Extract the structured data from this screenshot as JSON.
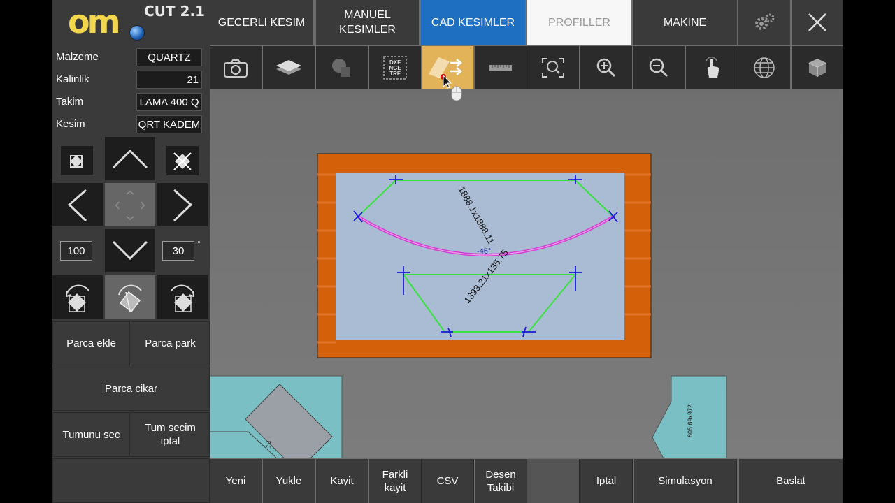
{
  "logo": {
    "brand": "om",
    "version": "CUT 2.1"
  },
  "properties": [
    {
      "label": "Malzeme",
      "value": "QUARTZ"
    },
    {
      "label": "Kalinlik",
      "value": "21"
    },
    {
      "label": "Takim",
      "value": "LAMA 400 Q"
    },
    {
      "label": "Kesim",
      "value": "QRT KADEM"
    }
  ],
  "jog": {
    "speed": "100",
    "angle": "30",
    "angle_unit": "°"
  },
  "left_buttons": {
    "add_part": "Parca ekle",
    "park_part": "Parca park",
    "remove_part": "Parca cikar",
    "select_all": "Tumunu sec",
    "cancel_selection": "Tum secim\niptal"
  },
  "tabs": [
    {
      "label": "GECERLI KESIM"
    },
    {
      "label": "MANUEL\nKESIMLER"
    },
    {
      "label": "CAD KESIMLER"
    },
    {
      "label": "PROFILLER"
    },
    {
      "label": "MAKINE"
    }
  ],
  "toolbar_icons": [
    "camera-icon",
    "layers-icon",
    "shapes-icon",
    "dxf-import-icon",
    "cad-transfer-icon",
    "ruler-icon",
    "zoom-fit-icon",
    "zoom-in-icon",
    "zoom-out-icon",
    "touch-icon",
    "globe-icon",
    "cube-icon"
  ],
  "dxf_icon_text": [
    "DXF",
    "NGE",
    "TRF"
  ],
  "canvas": {
    "arc_label": "1888.1x1888.11",
    "angle_label": "-46°",
    "trapezoid_label": "1393.21x135.75",
    "right_piece_label": "805.69x972",
    "left_piece_label": "14"
  },
  "bottom_buttons": [
    {
      "label": "Yeni"
    },
    {
      "label": "Yukle"
    },
    {
      "label": "Kayit"
    },
    {
      "label": "Farkli\nkayit"
    },
    {
      "label": "CSV"
    },
    {
      "label": "Desen\nTakibi"
    },
    {
      "label": ""
    },
    {
      "label": "Iptal"
    },
    {
      "label": "Simulasyon"
    },
    {
      "label": "Baslat"
    }
  ],
  "colors": {
    "active_tab": "#1e6fc2",
    "active_tool": "#e3b35a",
    "slab_border": "#d4600a",
    "slab": "#a9bcd3",
    "cut_line": "#38e23e",
    "arc": "#d43cd0",
    "marker": "#1a1ae0",
    "park_piece": "#7abfc3"
  }
}
